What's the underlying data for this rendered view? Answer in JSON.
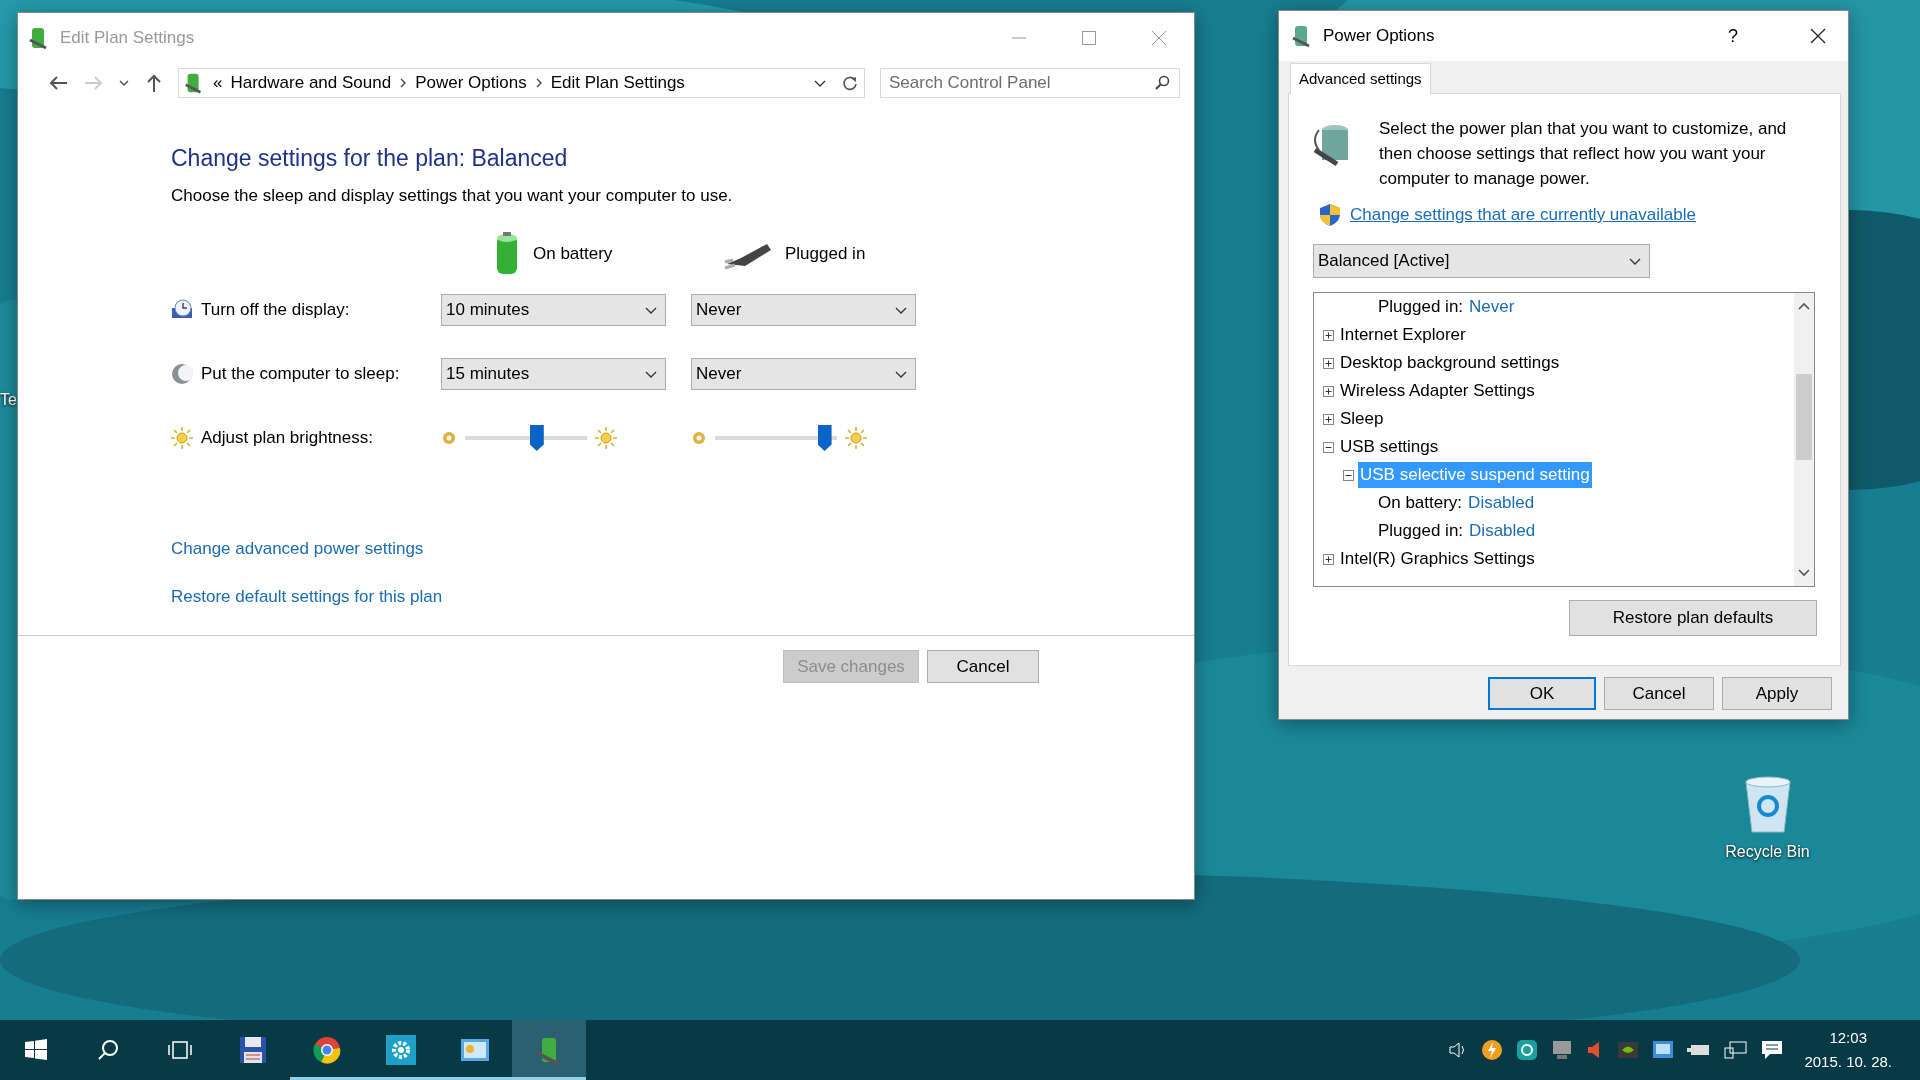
{
  "desktop": {
    "cut_label": "Te",
    "recycle_bin": {
      "label": "Recycle Bin"
    }
  },
  "edit_plan_window": {
    "title": "Edit Plan Settings",
    "nav": {
      "forward_disabled": true
    },
    "breadcrumb_overflow": "«",
    "breadcrumb": [
      "Hardware and Sound",
      "Power Options",
      "Edit Plan Settings"
    ],
    "search": {
      "placeholder": "Search Control Panel"
    },
    "heading": "Change settings for the plan: Balanced",
    "subtitle": "Choose the sleep and display settings that you want your computer to use.",
    "columns": [
      "On battery",
      "Plugged in"
    ],
    "settings": [
      {
        "kind": "dropdown",
        "label": "Turn off the display:",
        "values": [
          {
            "value": "10 minutes"
          },
          {
            "value": "Never"
          }
        ]
      },
      {
        "kind": "dropdown",
        "label": "Put the computer to sleep:",
        "values": [
          {
            "value": "15 minutes"
          },
          {
            "value": "Never"
          }
        ]
      },
      {
        "kind": "slider",
        "label": "Adjust plan brightness:",
        "values": [
          {
            "level": 0.6
          },
          {
            "level": 0.95
          }
        ]
      }
    ],
    "links": [
      "Change advanced power settings",
      "Restore default settings for this plan"
    ],
    "buttons": [
      {
        "label": "Save changes",
        "disabled": true
      },
      {
        "label": "Cancel",
        "disabled": false
      }
    ]
  },
  "power_options_dialog": {
    "title": "Power Options",
    "help": "?",
    "tabs": [
      {
        "label": "Advanced settings",
        "selected": true
      }
    ],
    "description": "Select the power plan that you want to customize, and then choose settings that reflect how you want your computer to manage power.",
    "admin_link": "Change settings that are currently unavailable",
    "plan_select": {
      "value": "Balanced [Active]"
    },
    "tree": [
      {
        "kind": "setting",
        "label": "Plugged in:",
        "value": "Never",
        "selected": false
      },
      {
        "kind": "group",
        "label": "Internet Explorer",
        "expanded": false,
        "selected": false
      },
      {
        "kind": "group",
        "label": "Desktop background settings",
        "expanded": false,
        "selected": false
      },
      {
        "kind": "group",
        "label": "Wireless Adapter Settings",
        "expanded": false,
        "selected": false
      },
      {
        "kind": "group",
        "label": "Sleep",
        "expanded": false,
        "selected": false
      },
      {
        "kind": "group",
        "label": "USB settings",
        "expanded": true,
        "selected": false,
        "children": [
          {
            "kind": "group",
            "label": "USB selective suspend setting",
            "expanded": true,
            "selected": true,
            "children": [
              {
                "kind": "setting",
                "label": "On battery:",
                "value": "Disabled",
                "selected": false
              },
              {
                "kind": "setting",
                "label": "Plugged in:",
                "value": "Disabled",
                "selected": false
              }
            ]
          }
        ]
      },
      {
        "kind": "group",
        "label": "Intel(R) Graphics Settings",
        "expanded": false,
        "selected": false
      }
    ],
    "restore_button": "Restore plan defaults",
    "buttons": [
      {
        "label": "OK",
        "default": true
      },
      {
        "label": "Cancel",
        "default": false
      },
      {
        "label": "Apply",
        "default": false
      }
    ]
  },
  "taskbar": {
    "apps": [
      {
        "running": false,
        "selected": false
      },
      {
        "running": true,
        "selected": false
      },
      {
        "running": true,
        "selected": false
      },
      {
        "running": true,
        "selected": false
      },
      {
        "running": true,
        "selected": true
      }
    ],
    "clock": {
      "time": "12:03",
      "date": "2015. 10. 28."
    }
  }
}
